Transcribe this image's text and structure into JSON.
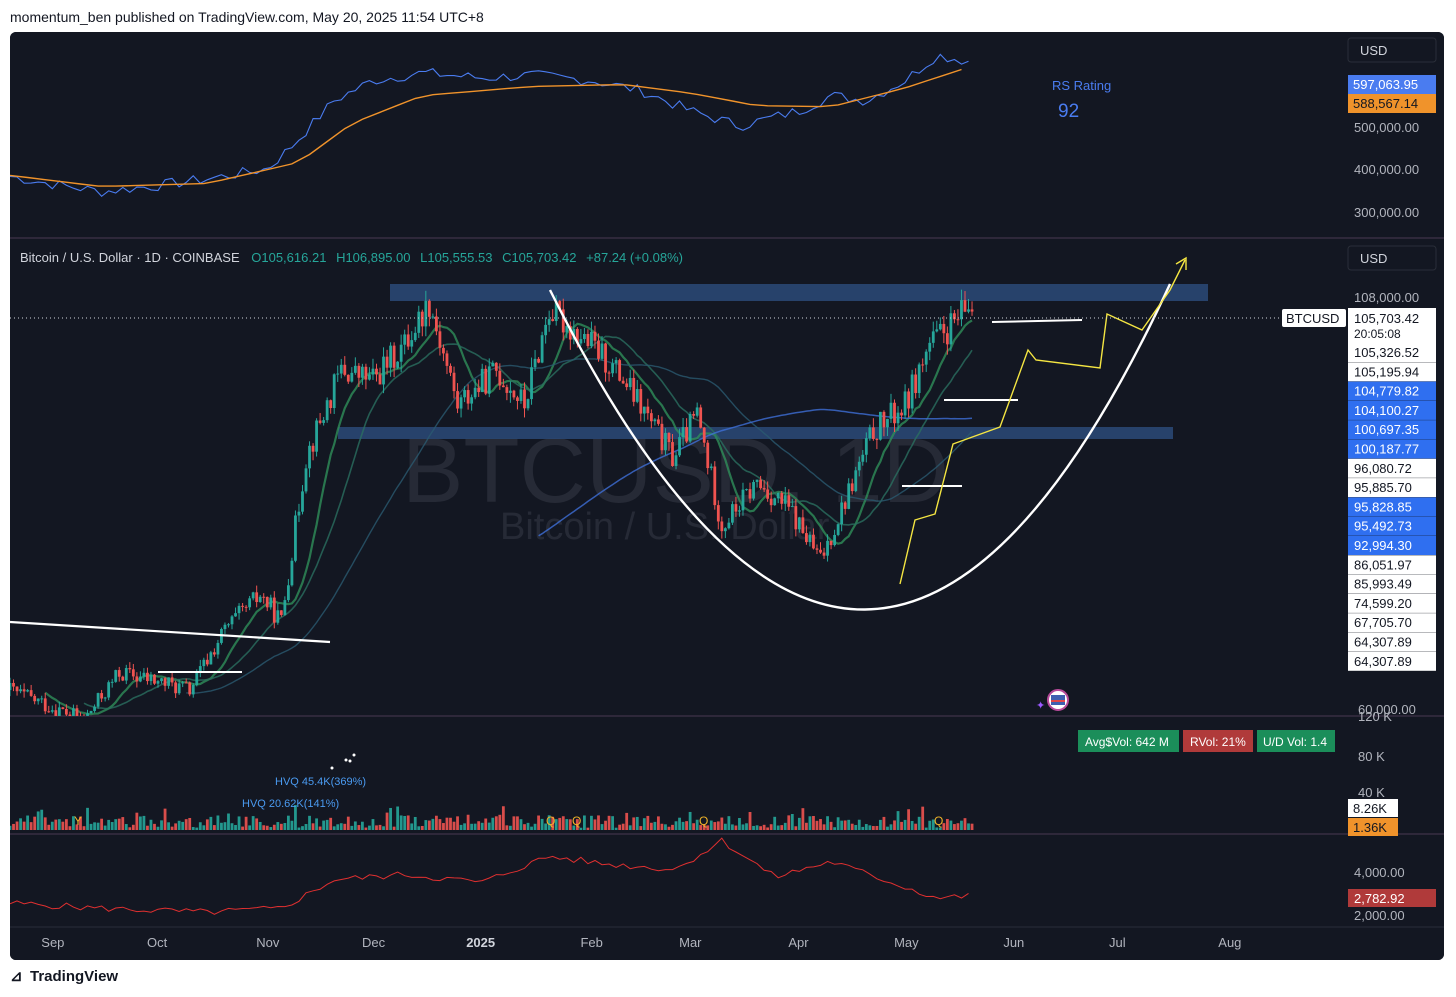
{
  "header": {
    "published_by": "momentum_ben published on TradingView.com, May 20, 2025 11:54 UTC+8"
  },
  "footer": {
    "brand": "TradingView"
  },
  "colors": {
    "background": "#131722",
    "up": "#26a69a",
    "down": "#ef5350",
    "rs_line": "#4a7cf0",
    "rs_ma": "#f0932b",
    "pattern": "#ffffff",
    "projection": "#f5e642",
    "zone": "#2c4a78",
    "lower_line": "#e03030"
  },
  "chart_data": [
    {
      "type": "line",
      "panel": "rs",
      "currency": "USD",
      "annotation": {
        "label": "RS Rating",
        "value": "92"
      },
      "y_ticks": [
        "500,000.00",
        "400,000.00",
        "300,000.00"
      ],
      "ylim": [
        260000,
        640000
      ],
      "series": [
        {
          "value_label": "597,063.95",
          "x": [
            "2025-08-20",
            "2024-09-01",
            "2024-09-15",
            "2024-10-01",
            "2024-10-15",
            "2024-11-01",
            "2024-11-08",
            "2024-11-20",
            "2024-12-01",
            "2024-12-15",
            "2025-01-01",
            "2025-01-15",
            "2025-02-01",
            "2025-02-15",
            "2025-03-01",
            "2025-03-15",
            "2025-04-01",
            "2025-04-10",
            "2025-04-20",
            "2025-05-01",
            "2025-05-10",
            "2025-05-20"
          ],
          "values": [
            370000,
            355000,
            340000,
            352000,
            365000,
            385000,
            430000,
            520000,
            560000,
            575000,
            565000,
            570000,
            560000,
            540000,
            500000,
            470000,
            500000,
            530000,
            520000,
            560000,
            610000,
            597063.95
          ]
        },
        {
          "value_label": "588,567.14",
          "x": [
            "2024-08-20",
            "2024-09-15",
            "2024-10-15",
            "2024-11-10",
            "2024-11-25",
            "2024-12-15",
            "2025-01-15",
            "2025-02-10",
            "2025-03-01",
            "2025-03-20",
            "2025-04-10",
            "2025-05-01",
            "2025-05-20"
          ],
          "values": [
            372000,
            350000,
            356000,
            398000,
            475000,
            530000,
            548000,
            552000,
            535000,
            510000,
            508000,
            545000,
            588567.14
          ]
        }
      ]
    },
    {
      "type": "candlestick",
      "panel": "price",
      "title": "Bitcoin / U.S. Dollar · 1D · COINBASE",
      "ohlc": {
        "open": "O105,616.21",
        "high": "H106,895.00",
        "low": "L105,555.53",
        "close": "C105,703.42",
        "change": "+87.24 (+0.08%)"
      },
      "watermark": {
        "symbol": "BTCUSD, 1D",
        "name": "Bitcoin / U.S. Dollar"
      },
      "currency": "USD",
      "symbol_tag": "BTCUSD",
      "last_price": "105,703.42",
      "countdown": "20:05:08",
      "y_ticks": [
        "108,000.00",
        "60,000.00"
      ],
      "ylim": [
        58000,
        113000
      ],
      "price_labels": [
        {
          "text": "105,326.52",
          "style": "light"
        },
        {
          "text": "105,195.94",
          "style": "light"
        },
        {
          "text": "104,779.82",
          "style": "blue"
        },
        {
          "text": "104,100.27",
          "style": "blue"
        },
        {
          "text": "100,697.35",
          "style": "blue"
        },
        {
          "text": "100,187.77",
          "style": "blue"
        },
        {
          "text": "96,080.72",
          "style": "light"
        },
        {
          "text": "95,885.70",
          "style": "light"
        },
        {
          "text": "95,828.85",
          "style": "blue"
        },
        {
          "text": "95,492.73",
          "style": "blue"
        },
        {
          "text": "92,994.30",
          "style": "blue"
        },
        {
          "text": "86,051.97",
          "style": "light"
        },
        {
          "text": "85,993.49",
          "style": "light"
        },
        {
          "text": "74,599.20",
          "style": "light"
        },
        {
          "text": "67,705.70",
          "style": "light"
        },
        {
          "text": "64,307.89",
          "style": "light"
        },
        {
          "text": "64,307.89",
          "style": "light"
        }
      ],
      "close_path": {
        "x": [
          "2024-08-20",
          "2024-09-01",
          "2024-09-10",
          "2024-09-20",
          "2024-10-01",
          "2024-10-10",
          "2024-10-20",
          "2024-10-30",
          "2024-11-05",
          "2024-11-12",
          "2024-11-22",
          "2024-12-01",
          "2024-12-10",
          "2024-12-17",
          "2024-12-25",
          "2025-01-05",
          "2025-01-13",
          "2025-01-20",
          "2025-02-01",
          "2025-02-10",
          "2025-02-24",
          "2025-03-03",
          "2025-03-10",
          "2025-03-20",
          "2025-03-29",
          "2025-04-07",
          "2025-04-15",
          "2025-04-22",
          "2025-05-01",
          "2025-05-08",
          "2025-05-14",
          "2025-05-20"
        ],
        "values": [
          61000,
          59000,
          57500,
          63000,
          62000,
          61000,
          68000,
          72000,
          69000,
          88000,
          98000,
          97000,
          101000,
          106000,
          94000,
          98000,
          94000,
          105000,
          101000,
          97000,
          88000,
          93000,
          80000,
          85000,
          82000,
          76000,
          84000,
          91000,
          94000,
          101000,
          103000,
          105703.42
        ]
      },
      "annotations": [
        "resistance zone near all-time high",
        "mid support zone",
        "cup arc",
        "projected path"
      ]
    },
    {
      "type": "bar",
      "panel": "volume",
      "badges": {
        "avg_vol": "Avg$Vol: 642 M",
        "rvol": "RVol: 21%",
        "ud_vol": "U/D Vol: 1.4"
      },
      "hvq_labels": [
        "HVQ 45.4K(369%)",
        "HVQ 20.62K(141%)"
      ],
      "markers": [
        "Y",
        "Q",
        "Q",
        "Q",
        "Q",
        "Q"
      ],
      "y_ticks": [
        "120 K",
        "80 K",
        "40 K"
      ],
      "current_values": [
        "8.26K",
        "1.36K"
      ],
      "ylim": [
        0,
        125000
      ]
    },
    {
      "type": "line",
      "panel": "indicator",
      "y_ticks": [
        "4,000.00",
        "2,000.00"
      ],
      "last_value": "2,782.92",
      "ylim": [
        1700,
        5000
      ],
      "x": [
        "2024-08-20",
        "2024-09-15",
        "2024-10-15",
        "2024-11-05",
        "2024-11-20",
        "2024-12-10",
        "2025-01-01",
        "2025-01-20",
        "2025-02-05",
        "2025-02-25",
        "2025-03-10",
        "2025-03-25",
        "2025-04-10",
        "2025-04-25",
        "2025-05-10",
        "2025-05-20"
      ],
      "values": [
        2500,
        2300,
        2150,
        2300,
        3400,
        3600,
        3300,
        4300,
        4000,
        3800,
        4900,
        3500,
        4100,
        3400,
        2700,
        2782.92
      ]
    }
  ],
  "x_axis": {
    "labels": [
      "Sep",
      "Oct",
      "Nov",
      "Dec",
      "2025",
      "Feb",
      "Mar",
      "Apr",
      "May",
      "Jun",
      "Jul",
      "Aug"
    ],
    "start": "2024-08-20",
    "end": "2025-08-31"
  }
}
